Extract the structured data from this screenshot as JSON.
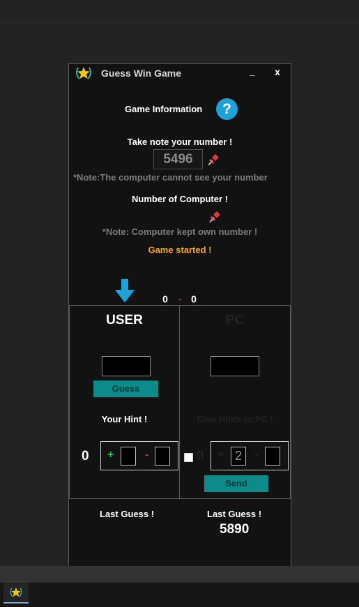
{
  "window": {
    "title": "Guess Win Game",
    "min_label": "_",
    "close_label": "x"
  },
  "info": {
    "game_info_label": "Game Information",
    "help_glyph": "?",
    "take_note_label": "Take note your number !",
    "user_number": "5496",
    "note_user": "*Note:The computer cannot see your number",
    "number_of_computer_label": "Number of Computer !",
    "note_computer": "*Note: Computer kept own number !",
    "status": "Game started !"
  },
  "score": {
    "user": "0",
    "separator": "-",
    "pc": "0"
  },
  "user_panel": {
    "title": "USER",
    "guess_value": "",
    "guess_button": "Guess",
    "hint_label": "Your Hint !",
    "count": "0",
    "plus_sign": "+",
    "minus_sign": "-",
    "plus_value": "",
    "minus_value": ""
  },
  "pc_panel": {
    "title": "PC",
    "guess_value": "",
    "hint_label": "Give Hints to PC !",
    "count": "0",
    "plus_sign": "+",
    "minus_sign": "-",
    "plus_value": "2",
    "minus_value": "",
    "send_button": "Send"
  },
  "last_guess": {
    "user_label": "Last Guess !",
    "user_value": "",
    "pc_label": "Last Guess !",
    "pc_value": "5890"
  },
  "colors": {
    "accent_teal": "#0d8a8a",
    "help_blue": "#1ea3d8",
    "status_orange": "#f5a623",
    "plus_green": "#2ecc40",
    "minus_red": "#d0312d"
  }
}
